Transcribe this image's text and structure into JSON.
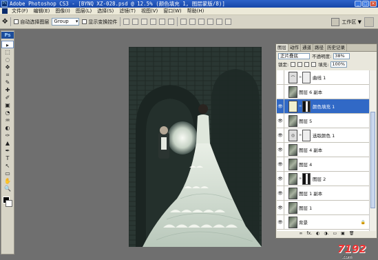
{
  "titlebar": {
    "title": "Adobe Photoshop CS3 - [BYNQ XZ-028.psd @ 12.5% (颜色填充 1, 图层蒙版/8)]",
    "controls": [
      "_",
      "□",
      "×"
    ]
  },
  "menubar": {
    "items": [
      "文件(F)",
      "编辑(E)",
      "图像(I)",
      "图层(L)",
      "选择(S)",
      "滤镜(T)",
      "视图(V)",
      "窗口(W)",
      "帮助(H)"
    ]
  },
  "options": {
    "auto_select_label": "自动选择图层",
    "group_value": "Group",
    "show_transform_label": "显示变换控件",
    "workspace_label": "工作区 ▼"
  },
  "toolbox": {
    "logo": "Ps",
    "tools": [
      "▸",
      "⬚",
      "◌",
      "✥",
      "⌗",
      "✎",
      "✚",
      "✐",
      "▣",
      "◔",
      "♒",
      "◐",
      "✑",
      "▲",
      "✒",
      "T",
      "↖",
      "▭",
      "✋",
      "🔍"
    ]
  },
  "layers_panel": {
    "tabs": [
      "图层",
      "动作",
      "通道",
      "路径",
      "历史记录"
    ],
    "blend_mode": "正片叠底",
    "opacity_label": "不透明度:",
    "opacity_value": "38%",
    "lock_label": "锁定:",
    "fill_label": "填充:",
    "fill_value": "100%",
    "layers": [
      {
        "name": "曲线 1",
        "visible": false,
        "selected": false,
        "thumb": "adj"
      },
      {
        "name": "图层 6 副本",
        "visible": false,
        "selected": false,
        "thumb": "photo"
      },
      {
        "name": "颜色填充 1",
        "visible": true,
        "selected": true,
        "thumb": "solid"
      },
      {
        "name": "图层 5",
        "visible": true,
        "selected": false,
        "thumb": "photo"
      },
      {
        "name": "选取颜色 1",
        "visible": true,
        "selected": false,
        "thumb": "adj"
      },
      {
        "name": "图层 4 副本",
        "visible": true,
        "selected": false,
        "thumb": "photo"
      },
      {
        "name": "图层 4",
        "visible": true,
        "selected": false,
        "thumb": "photo"
      },
      {
        "name": "图层 2",
        "visible": true,
        "selected": false,
        "thumb": "photo"
      },
      {
        "name": "图层 1 副本",
        "visible": true,
        "selected": false,
        "thumb": "photo"
      },
      {
        "name": "图层 1",
        "visible": true,
        "selected": false,
        "thumb": "photo"
      },
      {
        "name": "背景",
        "visible": true,
        "selected": false,
        "thumb": "photo"
      }
    ],
    "footer_icons": [
      "∞",
      "fx.",
      "◐",
      "◑.",
      "▭",
      "▣",
      "🗑"
    ]
  },
  "watermark": {
    "text": "7192",
    "sub": ".com"
  }
}
